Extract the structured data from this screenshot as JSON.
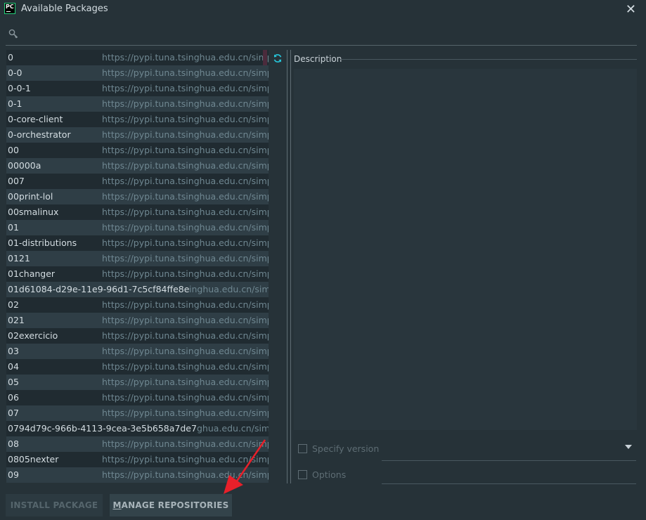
{
  "window": {
    "title": "Available Packages",
    "logo_text": "PC",
    "close_glyph": "✕"
  },
  "search": {
    "value": "",
    "placeholder": ""
  },
  "packages": [
    {
      "name": "0",
      "url": "https://pypi.tuna.tsinghua.edu.cn/simple/"
    },
    {
      "name": "0-0",
      "url": "https://pypi.tuna.tsinghua.edu.cn/simple/"
    },
    {
      "name": "0-0-1",
      "url": "https://pypi.tuna.tsinghua.edu.cn/simple/"
    },
    {
      "name": "0-1",
      "url": "https://pypi.tuna.tsinghua.edu.cn/simple/"
    },
    {
      "name": "0-core-client",
      "url": "https://pypi.tuna.tsinghua.edu.cn/simple/"
    },
    {
      "name": "0-orchestrator",
      "url": "https://pypi.tuna.tsinghua.edu.cn/simple/"
    },
    {
      "name": "00",
      "url": "https://pypi.tuna.tsinghua.edu.cn/simple/"
    },
    {
      "name": "00000a",
      "url": "https://pypi.tuna.tsinghua.edu.cn/simple/"
    },
    {
      "name": "007",
      "url": "https://pypi.tuna.tsinghua.edu.cn/simple/"
    },
    {
      "name": "00print-lol",
      "url": "https://pypi.tuna.tsinghua.edu.cn/simple/"
    },
    {
      "name": "00smalinux",
      "url": "https://pypi.tuna.tsinghua.edu.cn/simple/"
    },
    {
      "name": "01",
      "url": "https://pypi.tuna.tsinghua.edu.cn/simple/"
    },
    {
      "name": "01-distributions",
      "url": "https://pypi.tuna.tsinghua.edu.cn/simple/"
    },
    {
      "name": "0121",
      "url": "https://pypi.tuna.tsinghua.edu.cn/simple/"
    },
    {
      "name": "01changer",
      "url": "https://pypi.tuna.tsinghua.edu.cn/simple/"
    },
    {
      "name": "01d61084-d29e-11e9-96d1-7c5cf84ffe8e",
      "url": "inghua.edu.cn/simple/"
    },
    {
      "name": "02",
      "url": "https://pypi.tuna.tsinghua.edu.cn/simple/"
    },
    {
      "name": "021",
      "url": "https://pypi.tuna.tsinghua.edu.cn/simple/"
    },
    {
      "name": "02exercicio",
      "url": "https://pypi.tuna.tsinghua.edu.cn/simple/"
    },
    {
      "name": "03",
      "url": "https://pypi.tuna.tsinghua.edu.cn/simple/"
    },
    {
      "name": "04",
      "url": "https://pypi.tuna.tsinghua.edu.cn/simple/"
    },
    {
      "name": "05",
      "url": "https://pypi.tuna.tsinghua.edu.cn/simple/"
    },
    {
      "name": "06",
      "url": "https://pypi.tuna.tsinghua.edu.cn/simple/"
    },
    {
      "name": "07",
      "url": "https://pypi.tuna.tsinghua.edu.cn/simple/"
    },
    {
      "name": "0794d79c-966b-4113-9cea-3e5b658a7de7",
      "url": "ghua.edu.cn/simple/"
    },
    {
      "name": "08",
      "url": "https://pypi.tuna.tsinghua.edu.cn/simple/"
    },
    {
      "name": "0805nexter",
      "url": "https://pypi.tuna.tsinghua.edu.cn/simple/"
    },
    {
      "name": "09",
      "url": "https://pypi.tuna.tsinghua.edu.cn/simple/"
    }
  ],
  "description": {
    "header": "Description",
    "body": ""
  },
  "options": {
    "specify_version_label": "Specify version",
    "specify_version_checked": false,
    "options_label": "Options",
    "options_checked": false
  },
  "buttons": {
    "install_label": "INSTALL PACKAGE",
    "manage_label": "MANAGE REPOSITORIES"
  },
  "colors": {
    "background": "#263238",
    "row_dark": "#202b31",
    "row_light": "#2f3e46",
    "accent_refresh": "#26c6da",
    "annotation_arrow": "#e8202a"
  },
  "icons": {
    "search": "search-icon",
    "refresh": "refresh-icon",
    "close": "close-icon",
    "dropdown": "chevron-down-icon"
  }
}
